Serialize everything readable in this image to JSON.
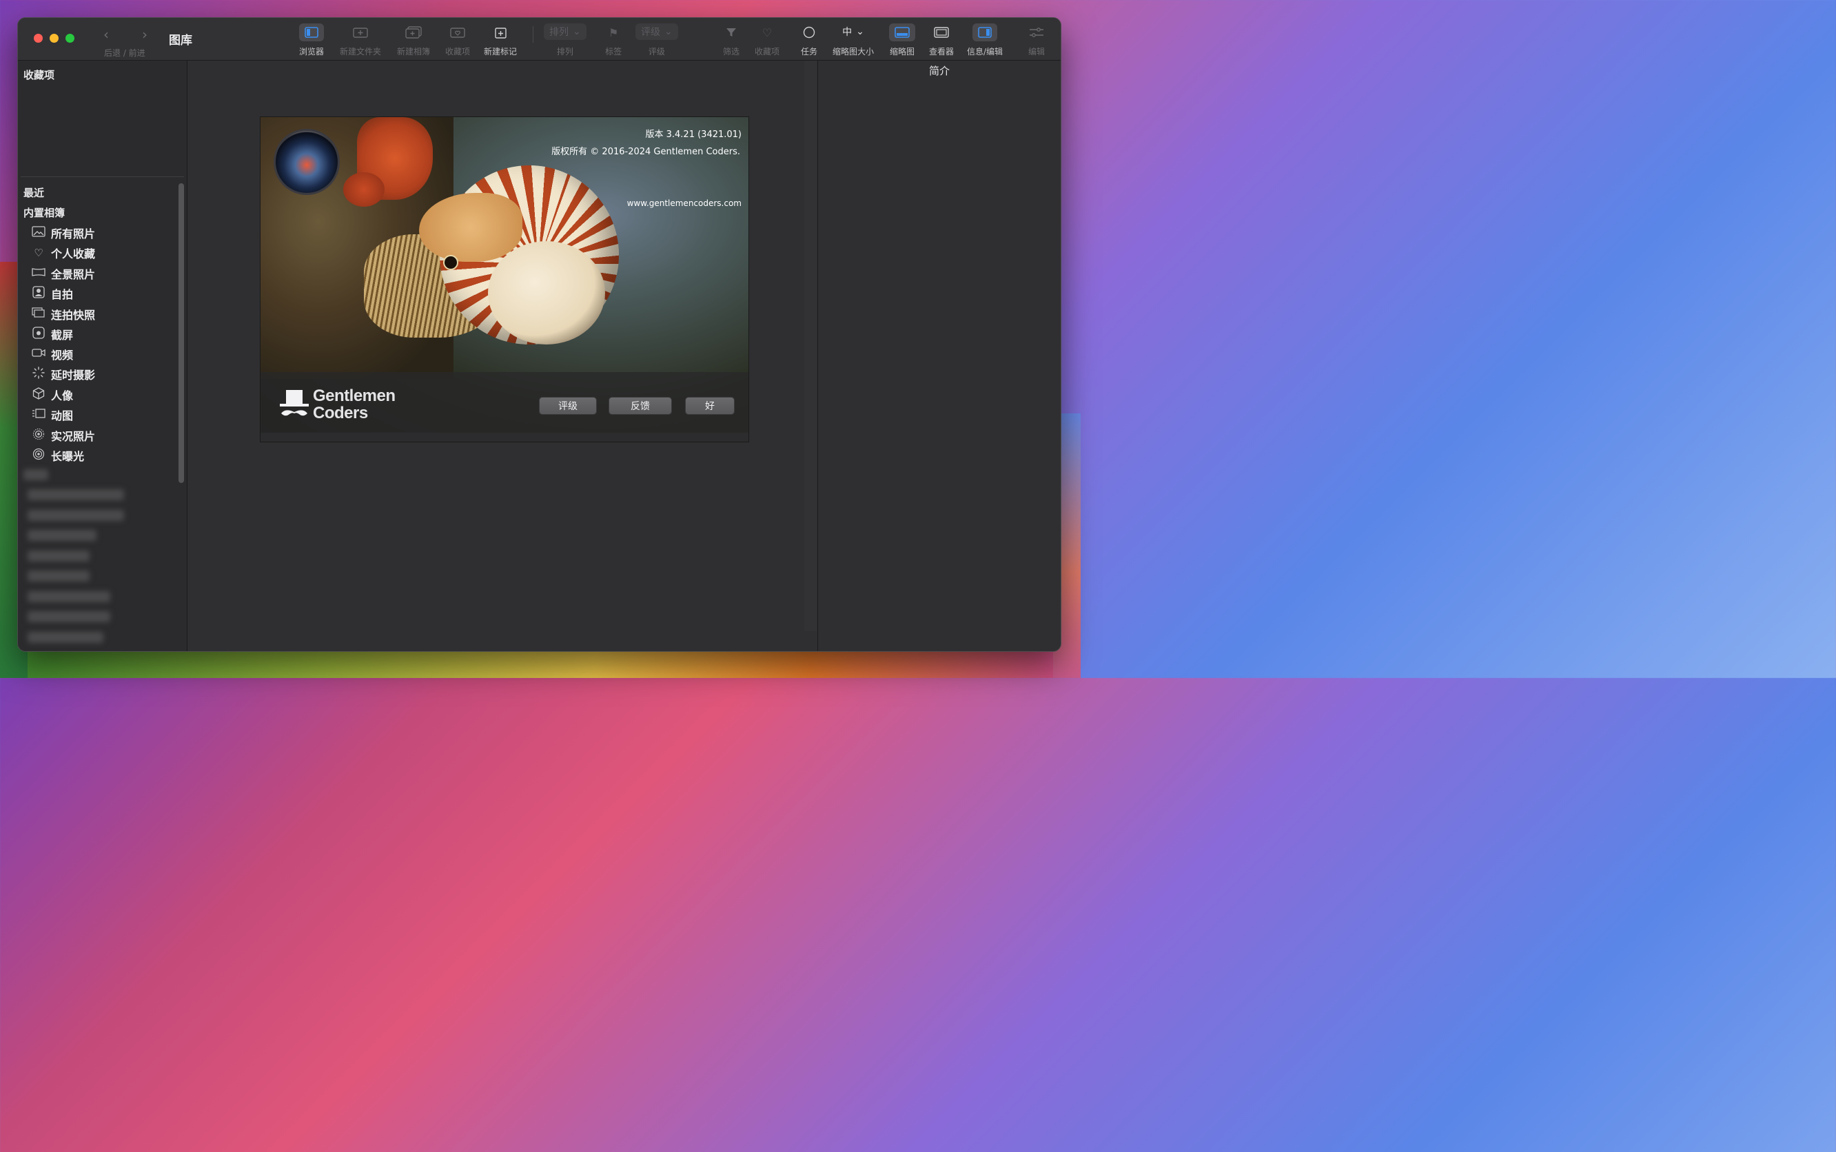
{
  "window": {
    "title": "图库",
    "nav_label": "后退 / 前进"
  },
  "toolbar": {
    "browser": "浏览器",
    "new_folder": "新建文件夹",
    "new_album": "新建相簿",
    "favorites": "收藏项",
    "new_tag": "新建标记",
    "sort_value": "排列",
    "sort": "排列",
    "label": "标签",
    "rating_value": "评级",
    "rating": "评级",
    "filter": "筛选",
    "favorites2": "收藏项",
    "tasks": "任务",
    "thumb_size_value": "中",
    "thumb_size": "缩略图大小",
    "thumbnails": "缩略图",
    "viewer": "查看器",
    "info_edit": "信息/编辑",
    "edit": "编辑"
  },
  "sidebar": {
    "favorites_header": "收藏项",
    "recent": "最近",
    "builtin_header": "内置相簿",
    "items": [
      {
        "label": "所有照片",
        "icon": "photos-icon"
      },
      {
        "label": "个人收藏",
        "icon": "heart-icon"
      },
      {
        "label": "全景照片",
        "icon": "panorama-icon"
      },
      {
        "label": "自拍",
        "icon": "selfie-icon"
      },
      {
        "label": "连拍快照",
        "icon": "burst-icon"
      },
      {
        "label": "截屏",
        "icon": "screenshot-icon"
      },
      {
        "label": "视频",
        "icon": "video-icon"
      },
      {
        "label": "延时摄影",
        "icon": "timelapse-icon"
      },
      {
        "label": "人像",
        "icon": "portrait-icon"
      },
      {
        "label": "动图",
        "icon": "animated-icon"
      },
      {
        "label": "实况照片",
        "icon": "live-photo-icon"
      },
      {
        "label": "长曝光",
        "icon": "long-exposure-icon"
      }
    ]
  },
  "info_panel": {
    "title": "简介"
  },
  "splash": {
    "version": "版本 3.4.21 (3421.01)",
    "copyright": "版权所有 © 2016-2024 Gentlemen Coders.",
    "url": "www.gentlemencoders.com",
    "logo_line1": "Gentlemen",
    "logo_line2": "Coders",
    "rate_button": "评级",
    "feedback_button": "反馈",
    "ok_button": "好"
  },
  "colors": {
    "accent": "#3b8ef0",
    "close": "#fe5f57",
    "minimize": "#febc2e",
    "zoom": "#28c840"
  }
}
